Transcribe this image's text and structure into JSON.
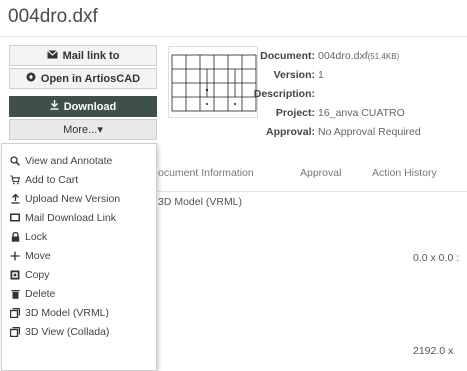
{
  "window": {
    "title": "004dro.dxf"
  },
  "actions": {
    "mail_link": "Mail link to",
    "open_artioscad": "Open in ArtiosCAD",
    "download": "Download",
    "more": "More...▾"
  },
  "metadata": {
    "document_label": "Document:",
    "document_value": "004dro.dxf",
    "document_size": "(51.4KB)",
    "version_label": "Version:",
    "version_value": "1",
    "description_label": "Description:",
    "description_value": "",
    "project_label": "Project:",
    "project_value": "16_anva CUATRO",
    "approval_label": "Approval:",
    "approval_value": "No Approval Required"
  },
  "tabs": [
    {
      "label": "ocument Information"
    },
    {
      "label": "Approval"
    },
    {
      "label": "Action History"
    }
  ],
  "subtab": "3D Model (VRML)",
  "background_values": [
    "0.0 x 0.0 :",
    "2192.0  x"
  ],
  "more_menu": [
    {
      "label": "View and Annotate",
      "icon": "magnifier-icon"
    },
    {
      "label": "Add to Cart",
      "icon": "cart-icon"
    },
    {
      "label": "Upload New Version",
      "icon": "upload-icon"
    },
    {
      "label": "Mail Download Link",
      "icon": "mail-icon"
    },
    {
      "label": "Lock",
      "icon": "lock-icon"
    },
    {
      "label": "Move",
      "icon": "move-icon"
    },
    {
      "label": "Copy",
      "icon": "copy-icon"
    },
    {
      "label": "Delete",
      "icon": "trash-icon"
    },
    {
      "label": "3D Model (VRML)",
      "icon": "cube-icon"
    },
    {
      "label": "3D View (Collada)",
      "icon": "cube-icon"
    }
  ],
  "colors": {
    "download_bg": "#3f4f4c",
    "menu_border": "#cfcfcf"
  }
}
